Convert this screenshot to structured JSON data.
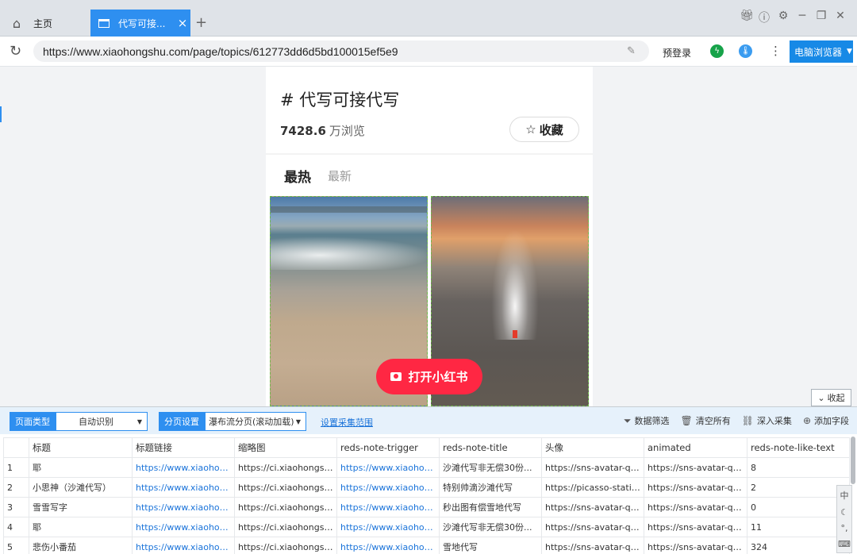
{
  "tabs": {
    "home_label": "主页",
    "active_label": "代写可接...",
    "new_tab": "+",
    "close": "×"
  },
  "window_controls": [
    "gift-icon",
    "help-icon",
    "settings-icon",
    "minimize-icon",
    "restore-icon",
    "close-icon"
  ],
  "address": {
    "url": "https://www.xiaohongshu.com/page/topics/612773dd6d5bd100015ef5e9",
    "prelogin": "预登录",
    "browser_mode": "电脑浏览器"
  },
  "page": {
    "topic_title": "# 代写可接代写",
    "view_count": "7428.6",
    "view_unit": "万浏览",
    "favorite": "收藏",
    "sort_hot": "最热",
    "sort_new": "最新",
    "open_app": "打开小红书",
    "collapse": "收起"
  },
  "panel": {
    "page_type_label": "页面类型",
    "page_type_value": "自动识别",
    "paging_label": "分页设置",
    "paging_value": "瀑布流分页(滚动加载)",
    "range_link": "设置采集范围",
    "actions": {
      "filter": "数据筛选",
      "clear": "清空所有",
      "deep": "深入采集",
      "add_field": "添加字段"
    },
    "columns": [
      "",
      "标题",
      "标题链接",
      "缩略图",
      "reds-note-trigger",
      "reds-note-title",
      "头像",
      "animated",
      "reds-note-like-text"
    ],
    "rows": [
      [
        "1",
        "耶",
        "https://www.xiaohongshu.com/",
        "https://ci.xiaohongshu.com/",
        "https://www.xiaohongshu.com/",
        "沙滩代写非无偿30份...",
        "https://sns-avatar-qc.xhscdn.com",
        "https://sns-avatar-qc.xhscdn.com",
        "8"
      ],
      [
        "2",
        "小思神（沙滩代写）",
        "https://www.xiaohongshu.com/",
        "https://ci.xiaohongshu.com/",
        "https://www.xiaohongshu.com/",
        "特别帅滴沙滩代写",
        "https://picasso-static.xhscdn.com",
        "https://sns-avatar-qc.xhscdn.com",
        "2"
      ],
      [
        "3",
        "雪雪写字",
        "https://www.xiaohongshu.com/",
        "https://ci.xiaohongshu.com/",
        "https://www.xiaohongshu.com/",
        "秒出图有偿雪地代写",
        "https://sns-avatar-qc.xhscdn.com",
        "https://sns-avatar-qc.xhscdn.com",
        "0"
      ],
      [
        "4",
        "耶",
        "https://www.xiaohongshu.com/",
        "https://ci.xiaohongshu.com/",
        "https://www.xiaohongshu.com/",
        "沙滩代写非无偿30份...",
        "https://sns-avatar-qc.xhscdn.com",
        "https://sns-avatar-qc.xhscdn.com",
        "11"
      ],
      [
        "5",
        "悲伤小番茄",
        "https://www.xiaohongshu.com/",
        "https://ci.xiaohongshu.com/",
        "https://www.xiaohongshu.com/",
        "雪地代写",
        "https://sns-avatar-qc.xhscdn.com",
        "https://sns-avatar-qc.xhscdn.com",
        "324"
      ]
    ],
    "ime": [
      "中",
      "☾",
      "°,",
      "⌨"
    ]
  },
  "colors": {
    "accent": "#2e8ff0",
    "brand_red": "#ff2743",
    "link": "#1a73d9"
  }
}
